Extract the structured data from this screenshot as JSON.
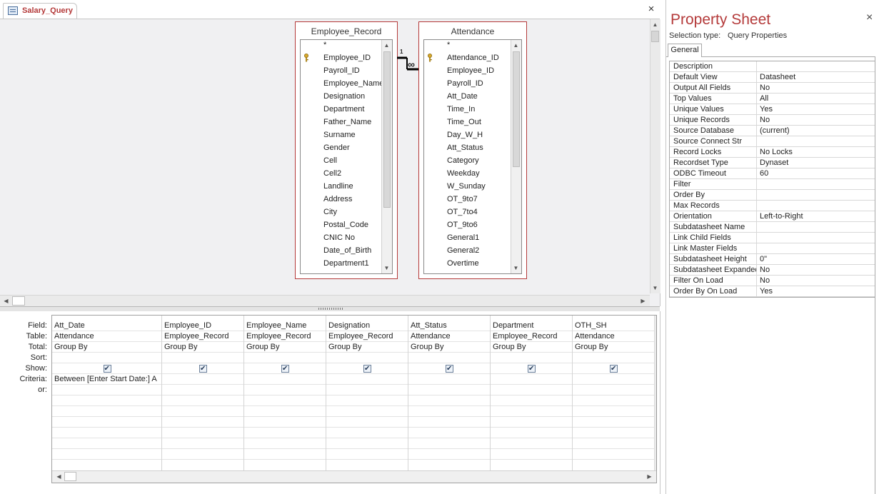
{
  "document_tab": {
    "label": "Salary_Query",
    "close_glyph": "×"
  },
  "icons": {
    "query_icon": "query-icon",
    "key_icon": "primary-key-icon",
    "close_icon": "close-icon"
  },
  "tables": [
    {
      "title": "Employee_Record",
      "fields": [
        "*",
        "Employee_ID",
        "Payroll_ID",
        "Employee_Name",
        "Designation",
        "Department",
        "Father_Name",
        "Surname",
        "Gender",
        "Cell",
        "Cell2",
        "Landline",
        "Address",
        "City",
        "Postal_Code",
        "CNIC No",
        "Date_of_Birth",
        "Department1"
      ],
      "key_field": "Employee_ID"
    },
    {
      "title": "Attendance",
      "fields": [
        "*",
        "Attendance_ID",
        "Employee_ID",
        "Payroll_ID",
        "Att_Date",
        "Time_In",
        "Time_Out",
        "Day_W_H",
        "Att_Status",
        "Category",
        "Weekday",
        "W_Sunday",
        "OT_9to7",
        "OT_7to4",
        "OT_9to6",
        "General1",
        "General2",
        "Overtime"
      ],
      "key_field": "Attendance_ID"
    }
  ],
  "relationship": {
    "one_label": "1",
    "many_label": "∞"
  },
  "grid": {
    "row_labels": [
      "Field:",
      "Table:",
      "Total:",
      "Sort:",
      "Show:",
      "Criteria:",
      "or:"
    ],
    "columns": [
      {
        "field": "Att_Date",
        "table": "Attendance",
        "total": "Group By",
        "sort": "",
        "show": true,
        "criteria": "Between [Enter Start Date:] A"
      },
      {
        "field": "Employee_ID",
        "table": "Employee_Record",
        "total": "Group By",
        "sort": "",
        "show": true,
        "criteria": ""
      },
      {
        "field": "Employee_Name",
        "table": "Employee_Record",
        "total": "Group By",
        "sort": "",
        "show": true,
        "criteria": ""
      },
      {
        "field": "Designation",
        "table": "Employee_Record",
        "total": "Group By",
        "sort": "",
        "show": true,
        "criteria": ""
      },
      {
        "field": "Att_Status",
        "table": "Attendance",
        "total": "Group By",
        "sort": "",
        "show": true,
        "criteria": ""
      },
      {
        "field": "Department",
        "table": "Employee_Record",
        "total": "Group By",
        "sort": "",
        "show": true,
        "criteria": ""
      },
      {
        "field": "OTH_SH",
        "table": "Attendance",
        "total": "Group By",
        "sort": "",
        "show": true,
        "criteria": ""
      }
    ]
  },
  "property_sheet": {
    "title": "Property Sheet",
    "selection_type_label": "Selection type:",
    "selection_type_value": "Query Properties",
    "tab": "General",
    "rows": [
      {
        "name": "Description",
        "value": ""
      },
      {
        "name": "Default View",
        "value": "Datasheet"
      },
      {
        "name": "Output All Fields",
        "value": "No"
      },
      {
        "name": "Top Values",
        "value": "All"
      },
      {
        "name": "Unique Values",
        "value": "Yes"
      },
      {
        "name": "Unique Records",
        "value": "No"
      },
      {
        "name": "Source Database",
        "value": "(current)"
      },
      {
        "name": "Source Connect Str",
        "value": ""
      },
      {
        "name": "Record Locks",
        "value": "No Locks"
      },
      {
        "name": "Recordset Type",
        "value": "Dynaset"
      },
      {
        "name": "ODBC Timeout",
        "value": "60"
      },
      {
        "name": "Filter",
        "value": ""
      },
      {
        "name": "Order By",
        "value": ""
      },
      {
        "name": "Max Records",
        "value": ""
      },
      {
        "name": "Orientation",
        "value": "Left-to-Right"
      },
      {
        "name": "Subdatasheet Name",
        "value": ""
      },
      {
        "name": "Link Child Fields",
        "value": ""
      },
      {
        "name": "Link Master Fields",
        "value": ""
      },
      {
        "name": "Subdatasheet Height",
        "value": "0\""
      },
      {
        "name": "Subdatasheet Expanded",
        "value": "No"
      },
      {
        "name": "Filter On Load",
        "value": "No"
      },
      {
        "name": "Order By On Load",
        "value": "Yes"
      }
    ]
  }
}
